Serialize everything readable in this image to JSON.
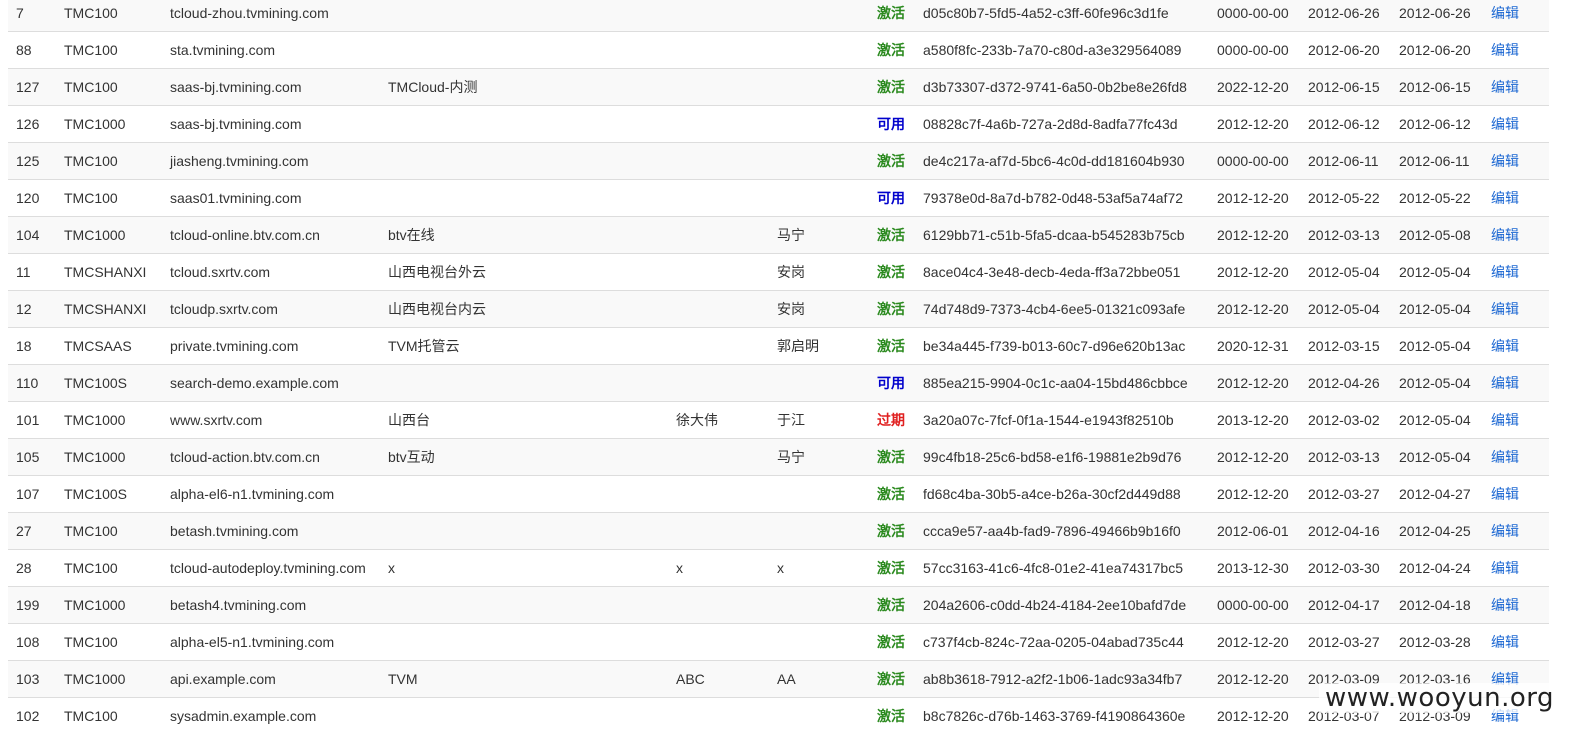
{
  "rows": [
    {
      "id": "7",
      "product": "TMC100",
      "domain": "tcloud-zhou.tvmining.com",
      "org": "",
      "sales": "",
      "contact": "",
      "status": "激活",
      "status_type": "active",
      "license": "d05c80b7-5fd5-4a52-c3ff-60fe96c3d1fe",
      "expire": "0000-00-00",
      "created": "2012-06-26",
      "updated": "2012-06-26",
      "action": "编辑"
    },
    {
      "id": "88",
      "product": "TMC100",
      "domain": "sta.tvmining.com",
      "org": "",
      "sales": "",
      "contact": "",
      "status": "激活",
      "status_type": "active",
      "license": "a580f8fc-233b-7a70-c80d-a3e329564089",
      "expire": "0000-00-00",
      "created": "2012-06-20",
      "updated": "2012-06-20",
      "action": "编辑"
    },
    {
      "id": "127",
      "product": "TMC100",
      "domain": "saas-bj.tvmining.com",
      "org": "TMCloud-内测",
      "sales": "",
      "contact": "",
      "status": "激活",
      "status_type": "active",
      "license": "d3b73307-d372-9741-6a50-0b2be8e26fd8",
      "expire": "2022-12-20",
      "created": "2012-06-15",
      "updated": "2012-06-15",
      "action": "编辑"
    },
    {
      "id": "126",
      "product": "TMC1000",
      "domain": "saas-bj.tvmining.com",
      "org": "",
      "sales": "",
      "contact": "",
      "status": "可用",
      "status_type": "usable",
      "license": "08828c7f-4a6b-727a-2d8d-8adfa77fc43d",
      "expire": "2012-12-20",
      "created": "2012-06-12",
      "updated": "2012-06-12",
      "action": "编辑"
    },
    {
      "id": "125",
      "product": "TMC100",
      "domain": "jiasheng.tvmining.com",
      "org": "",
      "sales": "",
      "contact": "",
      "status": "激活",
      "status_type": "active",
      "license": "de4c217a-af7d-5bc6-4c0d-dd181604b930",
      "expire": "0000-00-00",
      "created": "2012-06-11",
      "updated": "2012-06-11",
      "action": "编辑"
    },
    {
      "id": "120",
      "product": "TMC100",
      "domain": "saas01.tvmining.com",
      "org": "",
      "sales": "",
      "contact": "",
      "status": "可用",
      "status_type": "usable",
      "license": "79378e0d-8a7d-b782-0d48-53af5a74af72",
      "expire": "2012-12-20",
      "created": "2012-05-22",
      "updated": "2012-05-22",
      "action": "编辑"
    },
    {
      "id": "104",
      "product": "TMC1000",
      "domain": "tcloud-online.btv.com.cn",
      "org": "btv在线",
      "sales": "",
      "contact": "马宁",
      "status": "激活",
      "status_type": "active",
      "license": "6129bb71-c51b-5fa5-dcaa-b545283b75cb",
      "expire": "2012-12-20",
      "created": "2012-03-13",
      "updated": "2012-05-08",
      "action": "编辑"
    },
    {
      "id": "11",
      "product": "TMCSHANXI",
      "domain": "tcloud.sxrtv.com",
      "org": "山西电视台外云",
      "sales": "",
      "contact": "安岗",
      "status": "激活",
      "status_type": "active",
      "license": "8ace04c4-3e48-decb-4eda-ff3a72bbe051",
      "expire": "2012-12-20",
      "created": "2012-05-04",
      "updated": "2012-05-04",
      "action": "编辑"
    },
    {
      "id": "12",
      "product": "TMCSHANXI",
      "domain": "tcloudp.sxrtv.com",
      "org": "山西电视台内云",
      "sales": "",
      "contact": "安岗",
      "status": "激活",
      "status_type": "active",
      "license": "74d748d9-7373-4cb4-6ee5-01321c093afe",
      "expire": "2012-12-20",
      "created": "2012-05-04",
      "updated": "2012-05-04",
      "action": "编辑"
    },
    {
      "id": "18",
      "product": "TMCSAAS",
      "domain": "private.tvmining.com",
      "org": "TVM托管云",
      "sales": "",
      "contact": "郭启明",
      "status": "激活",
      "status_type": "active",
      "license": "be34a445-f739-b013-60c7-d96e620b13ac",
      "expire": "2020-12-31",
      "created": "2012-03-15",
      "updated": "2012-05-04",
      "action": "编辑"
    },
    {
      "id": "110",
      "product": "TMC100S",
      "domain": "search-demo.example.com",
      "org": "",
      "sales": "",
      "contact": "",
      "status": "可用",
      "status_type": "usable",
      "license": "885ea215-9904-0c1c-aa04-15bd486cbbce",
      "expire": "2012-12-20",
      "created": "2012-04-26",
      "updated": "2012-05-04",
      "action": "编辑"
    },
    {
      "id": "101",
      "product": "TMC1000",
      "domain": "www.sxrtv.com",
      "org": "山西台",
      "sales": "徐大伟",
      "contact": "于江",
      "status": "过期",
      "status_type": "expired",
      "license": "3a20a07c-7fcf-0f1a-1544-e1943f82510b",
      "expire": "2013-12-20",
      "created": "2012-03-02",
      "updated": "2012-05-04",
      "action": "编辑"
    },
    {
      "id": "105",
      "product": "TMC1000",
      "domain": "tcloud-action.btv.com.cn",
      "org": "btv互动",
      "sales": "",
      "contact": "马宁",
      "status": "激活",
      "status_type": "active",
      "license": "99c4fb18-25c6-bd58-e1f6-19881e2b9d76",
      "expire": "2012-12-20",
      "created": "2012-03-13",
      "updated": "2012-05-04",
      "action": "编辑"
    },
    {
      "id": "107",
      "product": "TMC100S",
      "domain": "alpha-el6-n1.tvmining.com",
      "org": "",
      "sales": "",
      "contact": "",
      "status": "激活",
      "status_type": "active",
      "license": "fd68c4ba-30b5-a4ce-b26a-30cf2d449d88",
      "expire": "2012-12-20",
      "created": "2012-03-27",
      "updated": "2012-04-27",
      "action": "编辑"
    },
    {
      "id": "27",
      "product": "TMC100",
      "domain": "betash.tvmining.com",
      "org": "",
      "sales": "",
      "contact": "",
      "status": "激活",
      "status_type": "active",
      "license": "ccca9e57-aa4b-fad9-7896-49466b9b16f0",
      "expire": "2012-06-01",
      "created": "2012-04-16",
      "updated": "2012-04-25",
      "action": "编辑"
    },
    {
      "id": "28",
      "product": "TMC100",
      "domain": "tcloud-autodeploy.tvmining.com",
      "org": "x",
      "sales": "x",
      "contact": "x",
      "status": "激活",
      "status_type": "active",
      "license": "57cc3163-41c6-4fc8-01e2-41ea74317bc5",
      "expire": "2013-12-30",
      "created": "2012-03-30",
      "updated": "2012-04-24",
      "action": "编辑"
    },
    {
      "id": "199",
      "product": "TMC1000",
      "domain": "betash4.tvmining.com",
      "org": "",
      "sales": "",
      "contact": "",
      "status": "激活",
      "status_type": "active",
      "license": "204a2606-c0dd-4b24-4184-2ee10bafd7de",
      "expire": "0000-00-00",
      "created": "2012-04-17",
      "updated": "2012-04-18",
      "action": "编辑"
    },
    {
      "id": "108",
      "product": "TMC100",
      "domain": "alpha-el5-n1.tvmining.com",
      "org": "",
      "sales": "",
      "contact": "",
      "status": "激活",
      "status_type": "active",
      "license": "c737f4cb-824c-72aa-0205-04abad735c44",
      "expire": "2012-12-20",
      "created": "2012-03-27",
      "updated": "2012-03-28",
      "action": "编辑"
    },
    {
      "id": "103",
      "product": "TMC1000",
      "domain": "api.example.com",
      "org": "TVM",
      "sales": "ABC",
      "contact": "AA",
      "status": "激活",
      "status_type": "active",
      "license": "ab8b3618-7912-a2f2-1b06-1adc93a34fb7",
      "expire": "2012-12-20",
      "created": "2012-03-09",
      "updated": "2012-03-16",
      "action": "编辑"
    },
    {
      "id": "102",
      "product": "TMC100",
      "domain": "sysadmin.example.com",
      "org": "",
      "sales": "",
      "contact": "",
      "status": "激活",
      "status_type": "active",
      "license": "b8c7826c-d76b-1463-3769-f4190864360e",
      "expire": "2012-12-20",
      "created": "2012-03-07",
      "updated": "2012-03-09",
      "action": "编辑"
    }
  ],
  "colors": {
    "active": "#2b8a1f",
    "usable": "#0000cc",
    "expired": "#e02020",
    "link": "#1a66d2"
  },
  "watermark": "www.wooyun.org"
}
